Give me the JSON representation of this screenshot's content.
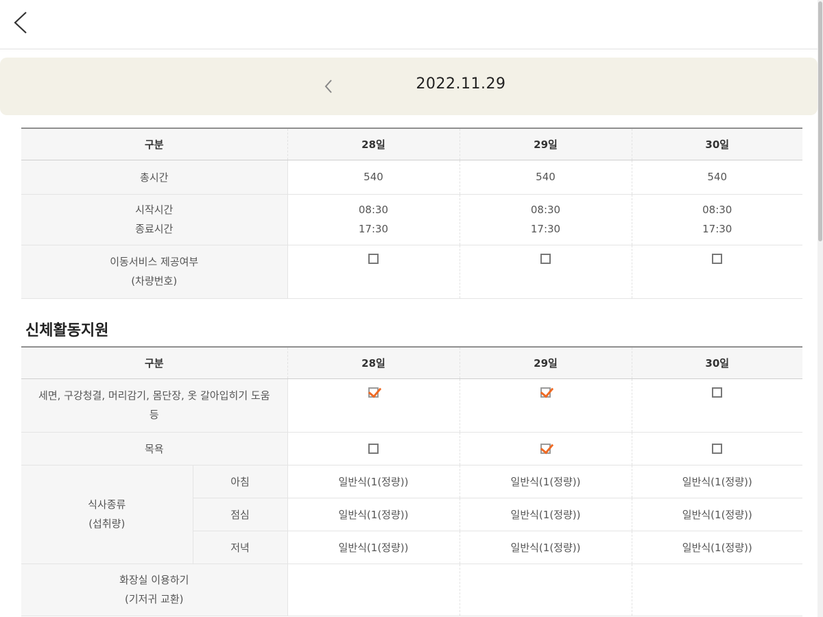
{
  "header": {
    "back_icon": "chevron-left-icon"
  },
  "date_nav": {
    "prev_icon": "chevron-left-icon",
    "date": "2022.11.29"
  },
  "schedule_table": {
    "headers": [
      "구분",
      "28일",
      "29일",
      "30일"
    ],
    "total_time": {
      "label": "총시간",
      "values": [
        "540",
        "540",
        "540"
      ]
    },
    "time_range": {
      "label_start": "시작시간",
      "label_end": "종료시간",
      "start": [
        "08:30",
        "08:30",
        "08:30"
      ],
      "end": [
        "17:30",
        "17:30",
        "17:30"
      ]
    },
    "transport": {
      "label_line1": "이동서비스 제공여부",
      "label_line2": "(차량번호)",
      "checked": [
        false,
        false,
        false
      ]
    }
  },
  "section": {
    "title": "신체활동지원"
  },
  "activity_table": {
    "headers": [
      "구분",
      "28일",
      "29일",
      "30일"
    ],
    "washing": {
      "label_line1": "세면, 구강청결, 머리감기, 몸단장, 옷 갈아입히기 도움",
      "label_line2": "등",
      "checked": [
        true,
        true,
        false
      ]
    },
    "bathing": {
      "label": "목욕",
      "checked": [
        false,
        true,
        false
      ]
    },
    "meals": {
      "label_line1": "식사종류",
      "label_line2": "(섭취량)",
      "rows": [
        {
          "label": "아침",
          "values": [
            "일반식(1(정량))",
            "일반식(1(정량))",
            "일반식(1(정량))"
          ]
        },
        {
          "label": "점심",
          "values": [
            "일반식(1(정량))",
            "일반식(1(정량))",
            "일반식(1(정량))"
          ]
        },
        {
          "label": "저녁",
          "values": [
            "일반식(1(정량))",
            "일반식(1(정량))",
            "일반식(1(정량))"
          ]
        }
      ]
    },
    "toilet": {
      "label_line1": "화장실 이용하기",
      "label_line2": "(기저귀 교환)"
    }
  },
  "colors": {
    "accent_check": "#ef6a24",
    "date_bar_bg": "#f3f1e7"
  }
}
